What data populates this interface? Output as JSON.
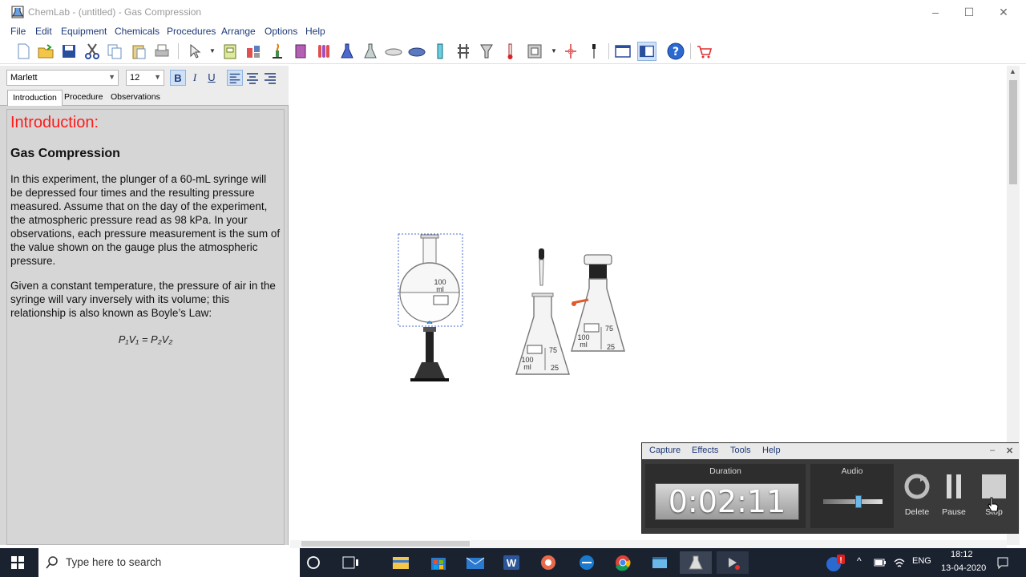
{
  "window": {
    "title": "ChemLab - (untitled) - Gas Compression",
    "controls": [
      "–",
      "☐",
      "✕"
    ]
  },
  "menu": [
    "File",
    "Edit",
    "Equipment",
    "Chemicals",
    "Procedures",
    "Arrange",
    "Options",
    "Help"
  ],
  "format": {
    "font": "Marlett",
    "size": "12",
    "bold": "B",
    "italic": "I",
    "underline": "U"
  },
  "tabs": [
    "Introduction",
    "Procedure",
    "Observations"
  ],
  "document": {
    "heading": "Introduction:",
    "subheading": "Gas Compression",
    "para1": "In this experiment, the plunger of a 60-mL syringe will be depressed four times and the resulting pressure measured.  Assume that on the day of the experiment, the atmospheric pressure read as 98 kPa. In your observations, each pressure measurement is the sum of the value shown on the gauge plus the atmospheric pressure.",
    "para2": "Given a constant temperature, the pressure of air in the syringe will vary inversely with its volume; this relationship is also known as Boyle’s Law:",
    "formula": "P₁V₁ = P₂V₂"
  },
  "apparatus": {
    "flask_label_top": "100",
    "flask_label_unit": "ml",
    "erlen_100": "100",
    "erlen_ml": "ml",
    "erlen_75": "75",
    "erlen_25": "25"
  },
  "recorder": {
    "menu": [
      "Capture",
      "Effects",
      "Tools",
      "Help"
    ],
    "duration_label": "Duration",
    "duration": "0:02:11",
    "audio_label": "Audio",
    "audio_level": 0.6,
    "delete": "Delete",
    "pause": "Pause",
    "stop": "Stop"
  },
  "taskbar": {
    "search_placeholder": "Type here to search",
    "language": "ENG",
    "time": "18:12",
    "date": "13-04-2020"
  }
}
